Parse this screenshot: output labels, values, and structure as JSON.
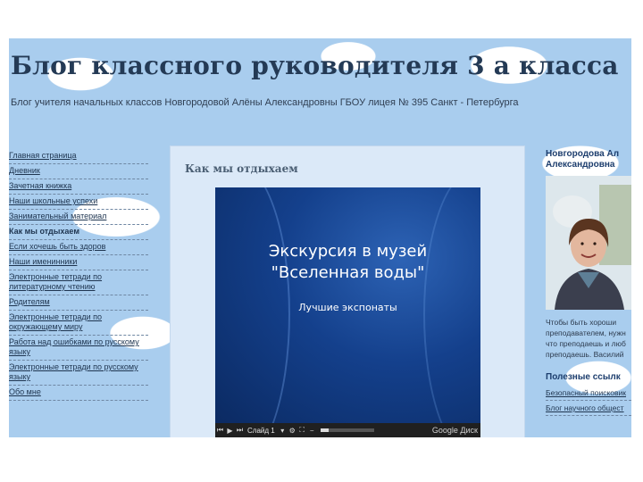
{
  "blog": {
    "title": "Блог классного руководителя 3 а класса",
    "description": "Блог учителя начальных классов Новгородовой Алёны Александровны ГБОУ лицея № 395 Санкт - Петербурга"
  },
  "sidebar_left": {
    "items": [
      {
        "label": "Главная страница"
      },
      {
        "label": "Дневник"
      },
      {
        "label": "Зачетная книжка"
      },
      {
        "label": "Наши школьные успехи"
      },
      {
        "label": "Занимательный материал"
      },
      {
        "label": "Как мы отдыхаем"
      },
      {
        "label": "Если хочешь быть здоров"
      },
      {
        "label": "Наши именинники"
      },
      {
        "label": "Электронные тетради по литературному чтению"
      },
      {
        "label": "Родителям"
      },
      {
        "label": "Электронные тетради по окружающему миру"
      },
      {
        "label": "Работа над ошибками по русскому языку"
      },
      {
        "label": "Электронные тетради по русскому языку"
      },
      {
        "label": "Обо мне"
      }
    ]
  },
  "post": {
    "title": "Как мы отдыхаем",
    "slide": {
      "title_line1": "Экскурсия в музей",
      "title_line2": "\"Вселенная воды\"",
      "subtitle": "Лучшие экспонаты"
    },
    "player": {
      "slide_label": "Слайд 1",
      "progress_fraction": 0.15,
      "brand": "Google Диск",
      "icons": [
        "skip-back-icon",
        "play-icon",
        "skip-forward-icon",
        "gear-icon",
        "fullscreen-icon",
        "minus-icon"
      ]
    }
  },
  "sidebar_right": {
    "author_line1": "Новгородова Ал",
    "author_line2": "Александровна",
    "quote_lines": [
      "Чтобы быть хороши",
      "преподавателем, нужн",
      "что преподаешь и люб",
      "преподаешь. Василий"
    ],
    "links_title": "Полезные ссылк",
    "links": [
      {
        "label": "Безопасный поисковик"
      },
      {
        "label": "Блог научного общест"
      }
    ]
  },
  "colors": {
    "sky": "#a9cdee",
    "post_background": "#dbe9f8",
    "slide_blue": "#14408c",
    "title_text": "#243a55",
    "link": "#1f3550"
  }
}
